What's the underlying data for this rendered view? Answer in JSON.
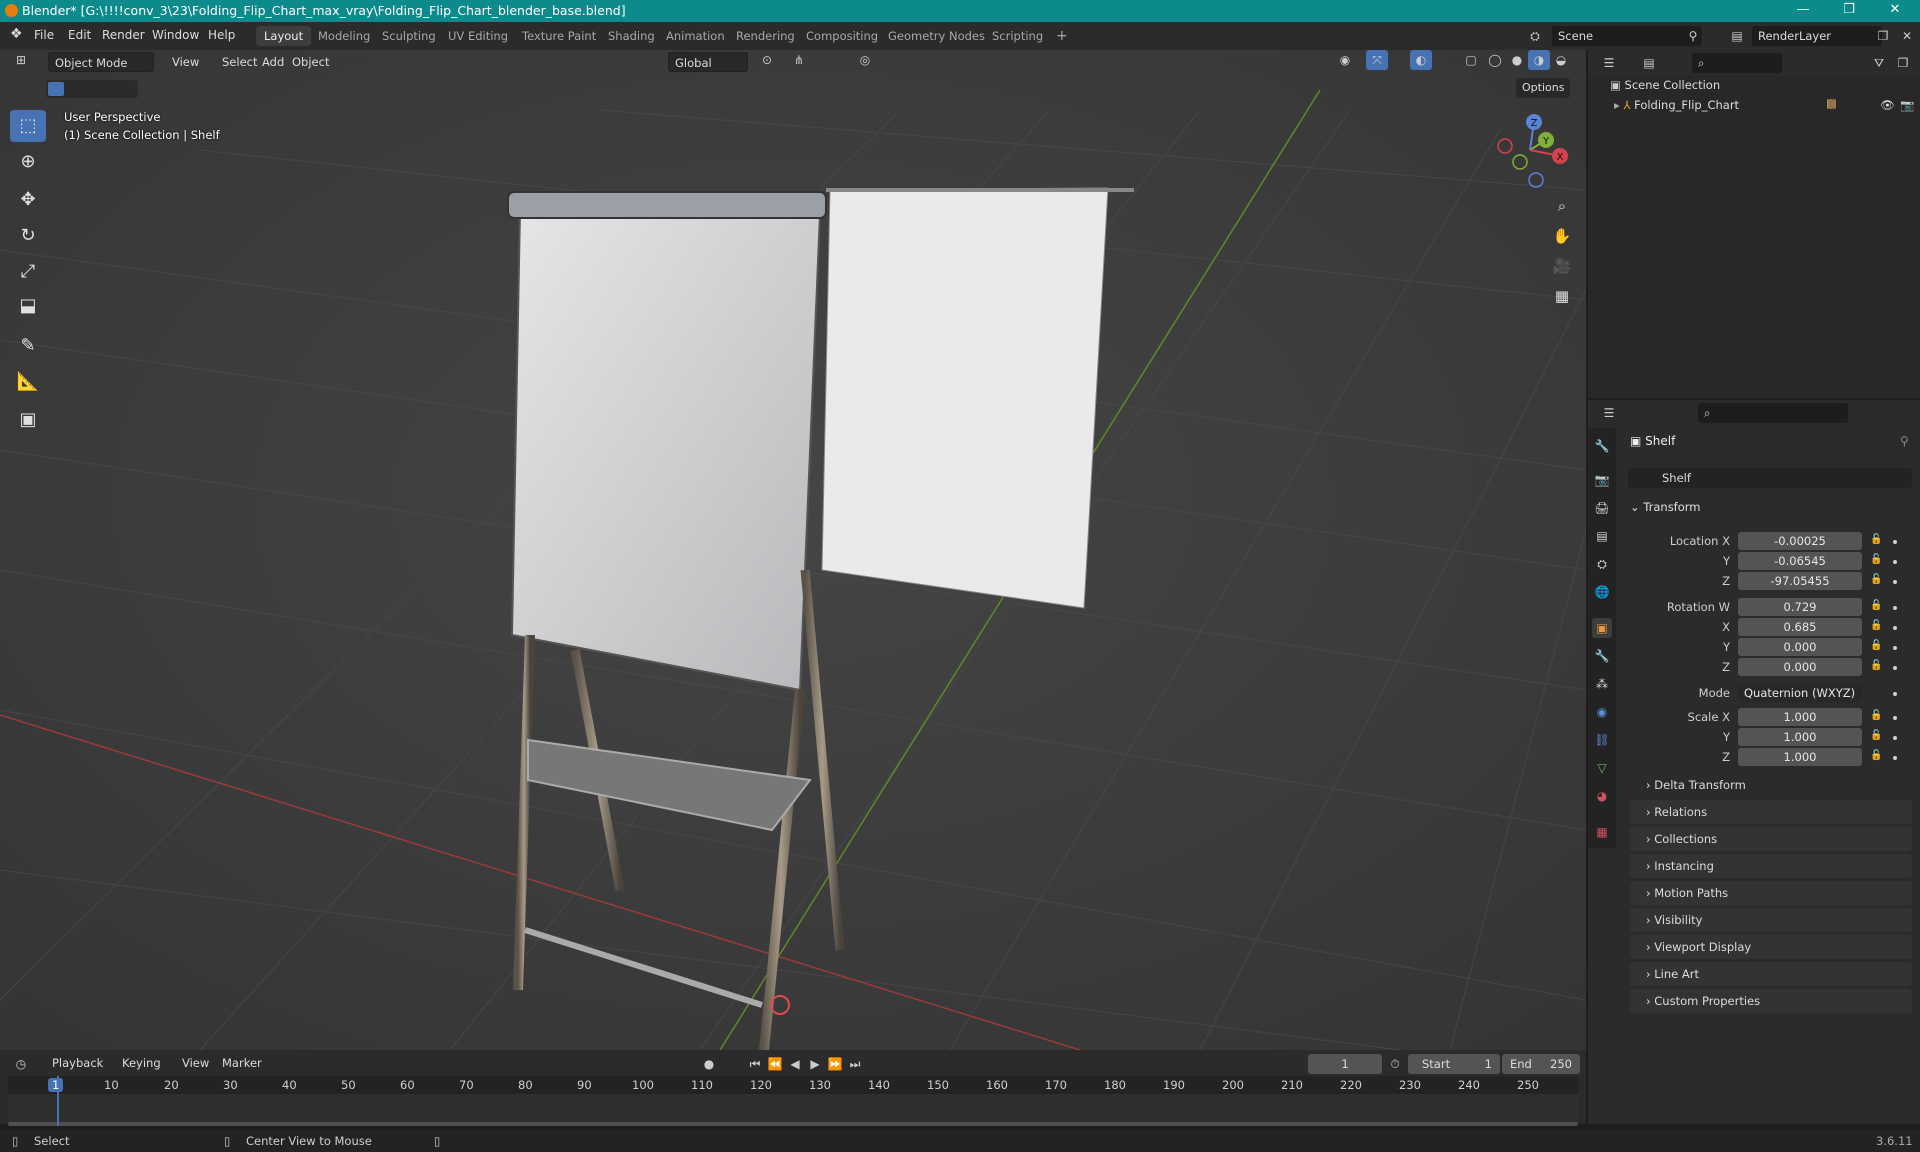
{
  "window": {
    "title": "Blender* [G:\\!!!!conv_3\\23\\Folding_Flip_Chart_max_vray\\Folding_Flip_Chart_blender_base.blend]",
    "minimize": "—",
    "maximize": "❐",
    "close": "✕"
  },
  "menu": [
    "File",
    "Edit",
    "Render",
    "Window",
    "Help"
  ],
  "workspaces": [
    "Layout",
    "Modeling",
    "Sculpting",
    "UV Editing",
    "Texture Paint",
    "Shading",
    "Animation",
    "Rendering",
    "Compositing",
    "Geometry Nodes",
    "Scripting"
  ],
  "workspace_add": "+",
  "scene_field": "Scene",
  "renderlayer_field": "RenderLayer",
  "viewport": {
    "mode": "Object Mode",
    "menus": [
      "View",
      "Select",
      "Add",
      "Object"
    ],
    "orientation": "Global",
    "options": "Options",
    "overlay_line1": "User Perspective",
    "overlay_line2": "(1) Scene Collection | Shelf",
    "gizmo": {
      "z": "Z",
      "y": "Y",
      "x": "X"
    }
  },
  "outliner": {
    "root": "Scene Collection",
    "item": "Folding_Flip_Chart"
  },
  "properties": {
    "object_name": "Shelf",
    "object_field": "Shelf",
    "transform_header": "Transform",
    "location_label_x": "Location X",
    "label_y": "Y",
    "label_z": "Z",
    "location": {
      "x": "-0.00025",
      "y": "-0.06545",
      "z": "-97.05455"
    },
    "rotation_label_w": "Rotation W",
    "label_x": "X",
    "rotation": {
      "w": "0.729",
      "x": "0.685",
      "y": "0.000",
      "z": "0.000"
    },
    "mode_label": "Mode",
    "mode_value": "Quaternion (WXYZ)",
    "scale_label_x": "Scale X",
    "scale": {
      "x": "1.000",
      "y": "1.000",
      "z": "1.000"
    },
    "delta_transform": "Delta Transform",
    "panels": [
      "Relations",
      "Collections",
      "Instancing",
      "Motion Paths",
      "Visibility",
      "Viewport Display",
      "Line Art",
      "Custom Properties"
    ]
  },
  "timeline": {
    "menus": [
      "Playback",
      "Keying",
      "View",
      "Marker"
    ],
    "current_frame": "1",
    "start_label": "Start",
    "start": "1",
    "end_label": "End",
    "end": "250",
    "frame_marks": [
      "1",
      "10",
      "20",
      "30",
      "40",
      "50",
      "60",
      "70",
      "80",
      "90",
      "100",
      "110",
      "120",
      "130",
      "140",
      "150",
      "160",
      "170",
      "180",
      "190",
      "200",
      "210",
      "220",
      "230",
      "240",
      "250"
    ]
  },
  "status": {
    "select": "Select",
    "center_view": "Center View to Mouse",
    "version": "3.6.11"
  }
}
